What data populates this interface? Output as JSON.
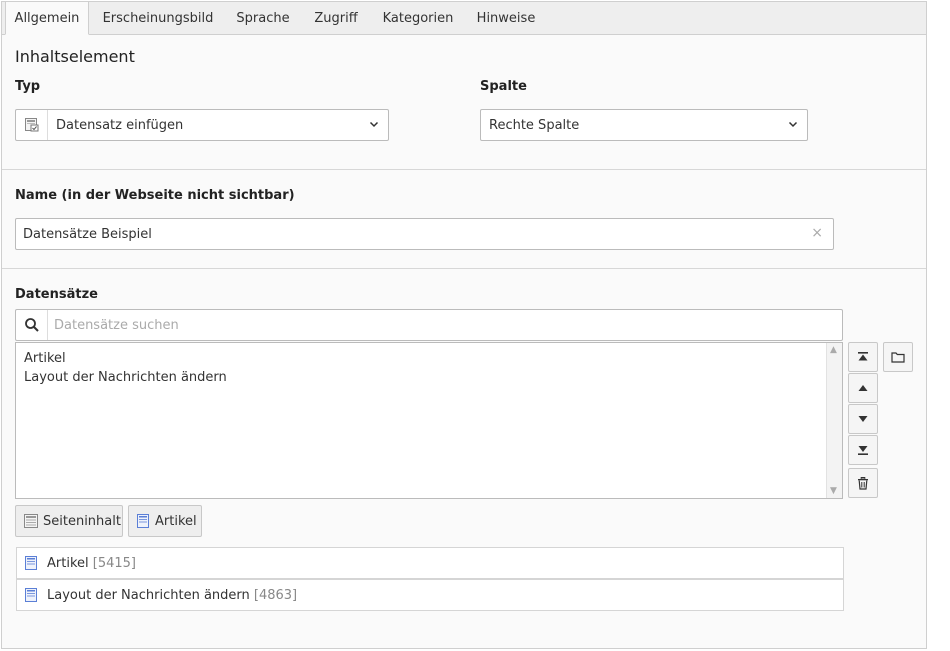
{
  "tabs": [
    {
      "label": "Allgemein",
      "active": true
    },
    {
      "label": "Erscheinungsbild",
      "active": false
    },
    {
      "label": "Sprache",
      "active": false
    },
    {
      "label": "Zugriff",
      "active": false
    },
    {
      "label": "Kategorien",
      "active": false
    },
    {
      "label": "Hinweise",
      "active": false
    }
  ],
  "content_element": {
    "heading": "Inhaltselement",
    "type_label": "Typ",
    "type_value": "Datensatz einfügen",
    "type_icon": "insert-record-icon",
    "column_label": "Spalte",
    "column_value": "Rechte Spalte"
  },
  "name_field": {
    "label": "Name (in der Webseite nicht sichtbar)",
    "value": "Datensätze Beispiel",
    "clear_glyph": "×"
  },
  "records": {
    "label": "Datensätze",
    "search_placeholder": "Datensätze suchen",
    "selected_items": [
      "Artikel",
      "Layout der Nachrichten ändern"
    ],
    "add_buttons": [
      {
        "label": "Seiteninhalt",
        "icon": "content-element-icon"
      },
      {
        "label": "Artikel",
        "icon": "page-icon"
      }
    ],
    "list": [
      {
        "title": "Artikel",
        "uid": "[5415]"
      },
      {
        "title": "Layout der Nachrichten ändern",
        "uid": "[4863]"
      }
    ]
  },
  "colors": {
    "tab_bar": "#eeeeee",
    "border": "#bbbbbb",
    "page_icon_blue": "#5b7fd6",
    "text": "#333333"
  }
}
